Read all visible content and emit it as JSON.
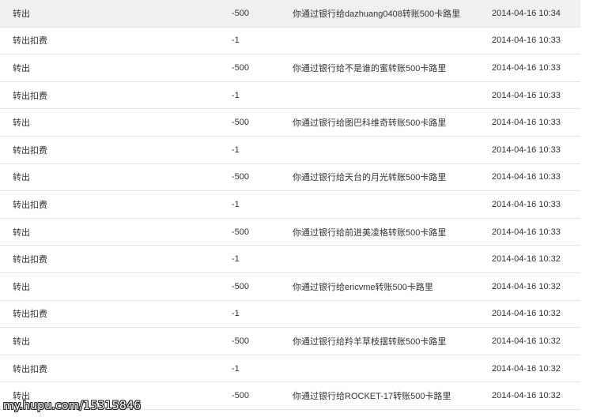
{
  "rows": [
    {
      "type": "转出",
      "amount": "-500",
      "desc": "你通过银行给dazhuang0408转账500卡路里",
      "time": "2014-04-16 10:34"
    },
    {
      "type": "转出扣费",
      "amount": "-1",
      "desc": "",
      "time": "2014-04-16 10:33"
    },
    {
      "type": "转出",
      "amount": "-500",
      "desc": "你通过银行给不是谁的蜜转账500卡路里",
      "time": "2014-04-16 10:33"
    },
    {
      "type": "转出扣费",
      "amount": "-1",
      "desc": "",
      "time": "2014-04-16 10:33"
    },
    {
      "type": "转出",
      "amount": "-500",
      "desc": "你通过银行给图巴科维奇转账500卡路里",
      "time": "2014-04-16 10:33"
    },
    {
      "type": "转出扣费",
      "amount": "-1",
      "desc": "",
      "time": "2014-04-16 10:33"
    },
    {
      "type": "转出",
      "amount": "-500",
      "desc": "你通过银行给天台的月光转账500卡路里",
      "time": "2014-04-16 10:33"
    },
    {
      "type": "转出扣费",
      "amount": "-1",
      "desc": "",
      "time": "2014-04-16 10:33"
    },
    {
      "type": "转出",
      "amount": "-500",
      "desc": "你通过银行给前进美凌格转账500卡路里",
      "time": "2014-04-16 10:33"
    },
    {
      "type": "转出扣费",
      "amount": "-1",
      "desc": "",
      "time": "2014-04-16 10:32"
    },
    {
      "type": "转出",
      "amount": "-500",
      "desc": "你通过银行给ericvme转账500卡路里",
      "time": "2014-04-16 10:32"
    },
    {
      "type": "转出扣费",
      "amount": "-1",
      "desc": "",
      "time": "2014-04-16 10:32"
    },
    {
      "type": "转出",
      "amount": "-500",
      "desc": "你通过银行给羚羊草枝摆转账500卡路里",
      "time": "2014-04-16 10:32"
    },
    {
      "type": "转出扣费",
      "amount": "-1",
      "desc": "",
      "time": "2014-04-16 10:32"
    },
    {
      "type": "转出",
      "amount": "-500",
      "desc": "你通过银行给ROCKET-17转账500卡路里",
      "time": "2014-04-16 10:32"
    }
  ],
  "watermark": "my.hupu.com/15315846"
}
